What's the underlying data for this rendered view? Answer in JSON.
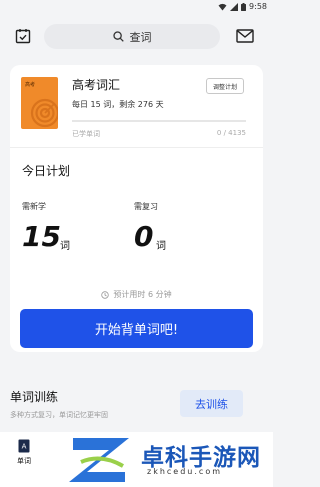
{
  "status_bar": {
    "time": "9:58"
  },
  "topbar": {
    "search_label": "查词"
  },
  "book": {
    "cover_text": "高考",
    "title": "高考词汇",
    "subtitle": "每日 15 词，剩余 276 天",
    "adjust_label": "调整计划",
    "learned_label": "已学单词",
    "learned_count": "0 / 4135",
    "progress": 0
  },
  "plan": {
    "heading": "今日计划",
    "new_label": "需新学",
    "new_count": "15",
    "review_label": "需复习",
    "review_count": "0",
    "unit": "词",
    "estimate": "预计用时 6 分钟",
    "start_label": "开始背单词吧!"
  },
  "training": {
    "title": "单词训练",
    "subtitle": "多种方式复习，单词记忆更牢固",
    "button_label": "去训练"
  },
  "nav": {
    "word_label": "单词"
  },
  "watermark": {
    "title": "卓科手游网",
    "url": "zkhcedu.com"
  },
  "colors": {
    "accent": "#1f52e8",
    "cover": "#f08a2a",
    "background": "#f3f4f6"
  }
}
